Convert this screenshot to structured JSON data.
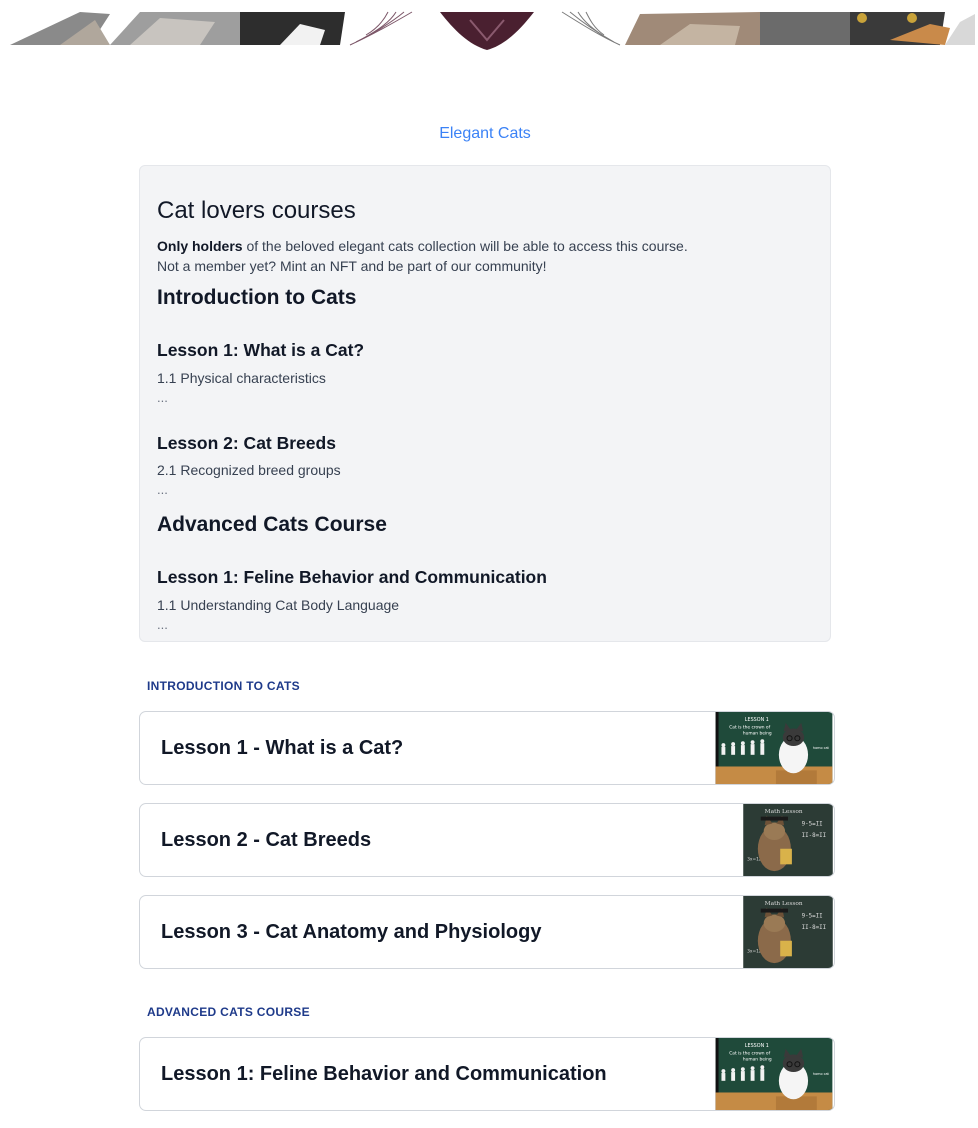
{
  "site": {
    "name": "Elegant Cats"
  },
  "overview": {
    "title": "Cat lovers courses",
    "intro_bold": "Only holders",
    "intro_rest": " of the beloved elegant cats collection will be able to access this course.",
    "intro_line2": "Not a member yet? Mint an NFT and be part of our community!",
    "sections": [
      {
        "heading": "Introduction to Cats",
        "lessons": [
          {
            "title": "Lesson 1: What is a Cat?",
            "sub": "1.1 Physical characteristics",
            "more": "..."
          },
          {
            "title": "Lesson 2: Cat Breeds",
            "sub": "2.1 Recognized breed groups",
            "more": "..."
          }
        ]
      },
      {
        "heading": "Advanced Cats Course",
        "lessons": [
          {
            "title": "Lesson 1: Feline Behavior and Communication",
            "sub": "1.1 Understanding Cat Body Language",
            "more": "..."
          }
        ]
      }
    ]
  },
  "lesson_sections": [
    {
      "label": "INTRODUCTION TO CATS",
      "cards": [
        {
          "title": "Lesson 1 - What is a Cat?",
          "thumb": "cat-teacher-evolution-thumbnail"
        },
        {
          "title": "Lesson 2 - Cat Breeds",
          "thumb": "cat-math-lesson-thumbnail"
        },
        {
          "title": "Lesson 3 - Cat Anatomy and Physiology",
          "thumb": "cat-math-lesson-thumbnail"
        }
      ]
    },
    {
      "label": "ADVANCED CATS COURSE",
      "cards": [
        {
          "title": "Lesson 1: Feline Behavior and Communication",
          "thumb": "cat-teacher-evolution-thumbnail"
        }
      ]
    }
  ],
  "colors": {
    "link": "#3b82f6",
    "section_label": "#1e3a8a",
    "card_bg": "#f3f4f6",
    "chalkboard": "#1f4a3a"
  }
}
